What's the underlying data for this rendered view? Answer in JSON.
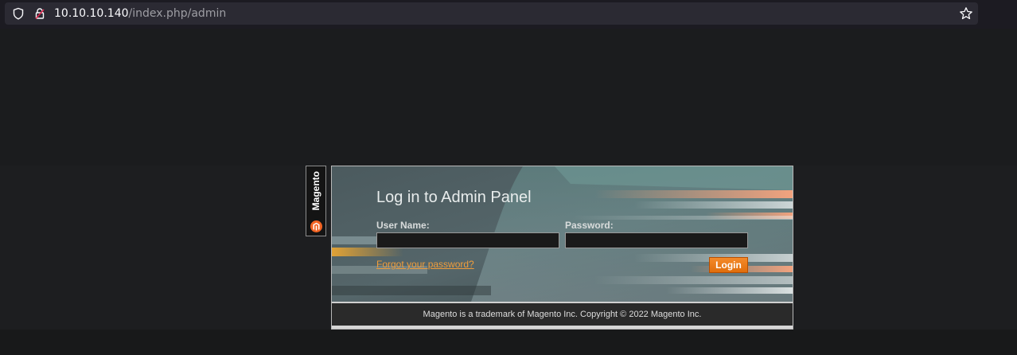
{
  "browser": {
    "url_host": "10.10.10.140",
    "url_path": "/index.php/admin",
    "icons": [
      "shield-icon",
      "lock-icon",
      "star-icon"
    ]
  },
  "sidebar": {
    "brand": "Magento",
    "logo_icon": "magento-logo-icon"
  },
  "login": {
    "title": "Log in to Admin Panel",
    "username_label": "User Name:",
    "username_value": "",
    "password_label": "Password:",
    "password_value": "",
    "forgot_link": "Forgot your password?",
    "login_button": "Login"
  },
  "footer": {
    "text": "Magento is a trademark of Magento Inc. Copyright © 2022 Magento Inc."
  },
  "colors": {
    "accent": "#f08a28",
    "link": "#f09d3b",
    "page_bg": "#1b1c1e"
  }
}
